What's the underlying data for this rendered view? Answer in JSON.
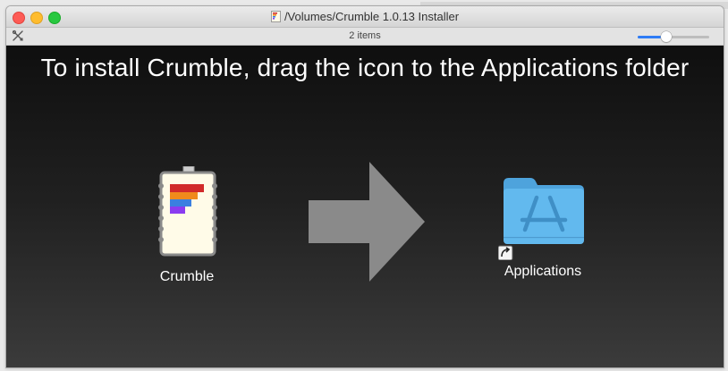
{
  "window": {
    "title": "/Volumes/Crumble 1.0.13 Installer",
    "item_count": "2 items",
    "zoom_level": 0.4
  },
  "content": {
    "instruction": "To install Crumble, drag the icon to the Applications folder",
    "items": [
      {
        "label": "Crumble",
        "icon": "crumble-app-icon"
      },
      {
        "label": "Applications",
        "icon": "applications-folder-icon"
      }
    ],
    "arrow_icon": "right-arrow-icon"
  },
  "colors": {
    "close": "#fd5b55",
    "minimize": "#febc2e",
    "zoom": "#28c840",
    "accent": "#2e7cf6",
    "folder": "#5fb8f0"
  }
}
